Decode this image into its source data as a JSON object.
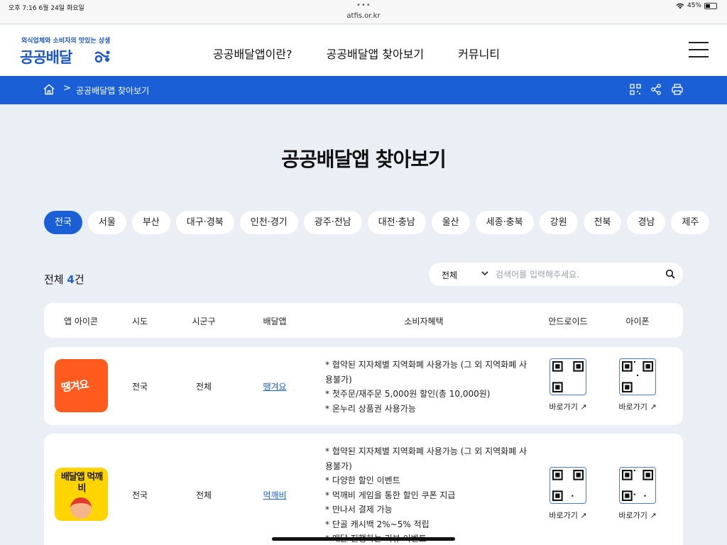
{
  "statusbar": {
    "time": "오후 7:16   6월 24일 화요일",
    "dots": "•••",
    "url": "atfis.or.kr",
    "battery_text": "45%"
  },
  "header": {
    "logo_tagline": "외식업체와 소비자의 맛있는 상생",
    "logo_text": "공공배달",
    "nav": [
      "공공배달앱이란?",
      "공공배달앱 찾아보기",
      "커뮤니티"
    ]
  },
  "breadcrumb": {
    "separator": ">",
    "current": "공공배달앱 찾아보기"
  },
  "page_title": "공공배달앱 찾아보기",
  "regions": [
    {
      "label": "전국",
      "active": true
    },
    {
      "label": "서울",
      "active": false
    },
    {
      "label": "부산",
      "active": false
    },
    {
      "label": "대구·경북",
      "active": false
    },
    {
      "label": "인천·경기",
      "active": false
    },
    {
      "label": "광주·전남",
      "active": false
    },
    {
      "label": "대전·충남",
      "active": false
    },
    {
      "label": "울산",
      "active": false
    },
    {
      "label": "세종·충북",
      "active": false
    },
    {
      "label": "강원",
      "active": false
    },
    {
      "label": "전북",
      "active": false
    },
    {
      "label": "경남",
      "active": false
    },
    {
      "label": "제주",
      "active": false
    }
  ],
  "result": {
    "prefix": "전체 ",
    "count": "4",
    "suffix": "건"
  },
  "search": {
    "select_value": "전체",
    "placeholder": "검색어를 입력해주세요."
  },
  "table": {
    "headers": [
      "앱 아이콘",
      "시도",
      "시군구",
      "배달앱",
      "소비자혜택",
      "안드로이드",
      "아이폰"
    ],
    "rows": [
      {
        "icon_text": "땡겨요",
        "sido": "전국",
        "sigungu": "전체",
        "app": "땡겨요",
        "benefits": [
          "* 협약된 지자체별 지역화폐 사용가능 (그 외 지역화폐 사용불가)",
          "* 첫주문/재주문 5,000원 할인(총 10,000원)",
          "* 온누리 상품권 사용가능"
        ],
        "android_link": "바로가기",
        "ios_link": "바로가기"
      },
      {
        "icon_text": "배달앱 먹깨비",
        "sido": "전국",
        "sigungu": "전체",
        "app": "먹깨비",
        "benefits": [
          "* 협약된 지자체별 지역화폐 사용가능 (그 외 지역화폐 사용불가)",
          "* 다양한 할인 이벤트",
          "* 먹깨비 게임을 통한 할인 쿠폰 지급",
          "* 만나서 결제 가능",
          "* 단골 캐시백 2%~5% 적립",
          "* 매달 진행하는 리뷰 이벤트"
        ],
        "android_link": "바로가기",
        "ios_link": "바로가기"
      }
    ]
  },
  "colors": {
    "primary": "#1a5fd6",
    "background": "#eaeef5",
    "ttaeng_orange": "#ff5b1f",
    "mukkaebi_yellow": "#ffd400"
  }
}
